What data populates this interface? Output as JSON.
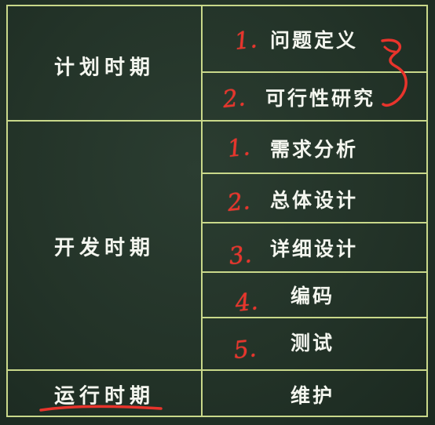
{
  "colors": {
    "board": "#233328",
    "grid_line": "#c9d88a",
    "chalk_text": "#f4f6ef",
    "annotation_red": "#e8342c"
  },
  "phases": [
    {
      "label": "计划时期",
      "stages": [
        {
          "number": "1.",
          "name": "问题定义"
        },
        {
          "number": "2.",
          "name": "可行性研究"
        }
      ]
    },
    {
      "label": "开发时期",
      "stages": [
        {
          "number": "1.",
          "name": "需求分析"
        },
        {
          "number": "2.",
          "name": "总体设计"
        },
        {
          "number": "3.",
          "name": "详细设计"
        },
        {
          "number": "4.",
          "name": "编码"
        },
        {
          "number": "5.",
          "name": "测试"
        }
      ]
    },
    {
      "label": "运行时期",
      "stages": [
        {
          "number": "",
          "name": "维护"
        }
      ]
    }
  ]
}
